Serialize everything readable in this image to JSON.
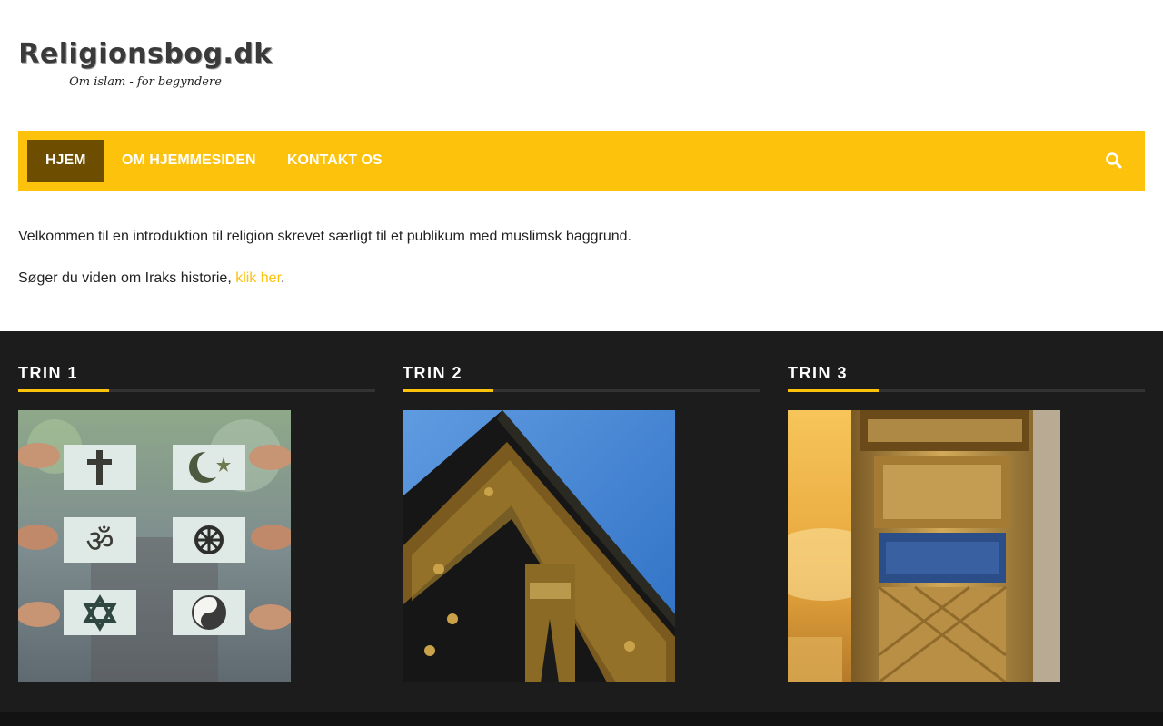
{
  "header": {
    "logo_title": "Religionsbog.dk",
    "logo_tagline": "Om islam - for begyndere"
  },
  "nav": {
    "items": [
      {
        "label": "HJEM",
        "active": true
      },
      {
        "label": "OM HJEMMESIDEN",
        "active": false
      },
      {
        "label": "KONTAKT OS",
        "active": false
      }
    ],
    "search_icon": "search-icon"
  },
  "intro": {
    "line1": "Velkommen til en introduktion til religion skrevet særligt til et publikum med muslimsk baggrund.",
    "line2_prefix": "Søger du viden om Iraks historie, ",
    "line2_link": "klik her",
    "line2_suffix": "."
  },
  "steps": [
    {
      "title": "TRIN 1",
      "image": "religious-symbols-image"
    },
    {
      "title": "TRIN 2",
      "image": "kaaba-image"
    },
    {
      "title": "TRIN 3",
      "image": "mosque-minaret-image"
    }
  ],
  "colors": {
    "accent": "#fdc20c",
    "nav_active": "#6d4d00",
    "dark_section": "#1c1c1c",
    "text": "#222222"
  }
}
